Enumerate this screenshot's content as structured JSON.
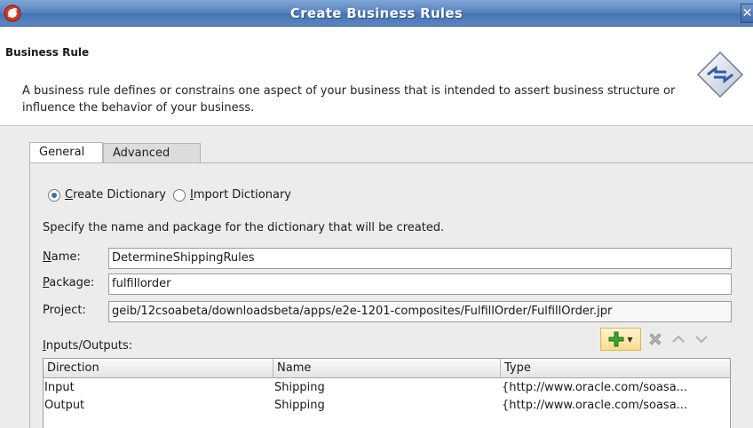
{
  "window": {
    "title": "Create Business Rules",
    "close_label": "✕"
  },
  "header": {
    "title": "Business Rule",
    "description": "A business rule defines or constrains one aspect of your business that is intended to assert business structure or influence the behavior of your business.",
    "icon": "business-rule-diamond-icon"
  },
  "tabs": [
    {
      "label": "General",
      "selected": true
    },
    {
      "label": "Advanced",
      "selected": false
    }
  ],
  "general": {
    "radio_create": {
      "mnemonic": "C",
      "rest": "reate Dictionary",
      "checked": true
    },
    "radio_import": {
      "mnemonic": "I",
      "rest": "mport Dictionary",
      "checked": false
    },
    "instruction": "Specify the name and package for the dictionary that will be created.",
    "name": {
      "mnemonic": "N",
      "rest": "ame:",
      "value": "DetermineShippingRules"
    },
    "package": {
      "mnemonic": "P",
      "rest": "ackage:",
      "value": "fulfillorder"
    },
    "project": {
      "label": "Project:",
      "value": "geib/12csoabeta/downloadsbeta/apps/e2e-1201-composites/FulfillOrder/FulfillOrder.jpr"
    },
    "io": {
      "mnemonic": "I",
      "rest": "nputs/Outputs:"
    },
    "toolbar": {
      "add_icon": "plus-icon",
      "delete_icon": "delete-x-icon",
      "move_up_icon": "move-up-icon",
      "move_down_icon": "move-down-icon",
      "add_color": "#3aa82e"
    },
    "table": {
      "columns": [
        "Direction",
        "Name",
        "Type"
      ],
      "rows": [
        {
          "direction": "Input",
          "name": "Shipping",
          "type": "{http://www.oracle.com/soasa..."
        },
        {
          "direction": "Output",
          "name": "Shipping",
          "type": "{http://www.oracle.com/soasa..."
        }
      ]
    }
  },
  "colors": {
    "titlebar": "#5b85c0",
    "accent": "#3d6fb0",
    "panel_bg": "#ececec"
  }
}
